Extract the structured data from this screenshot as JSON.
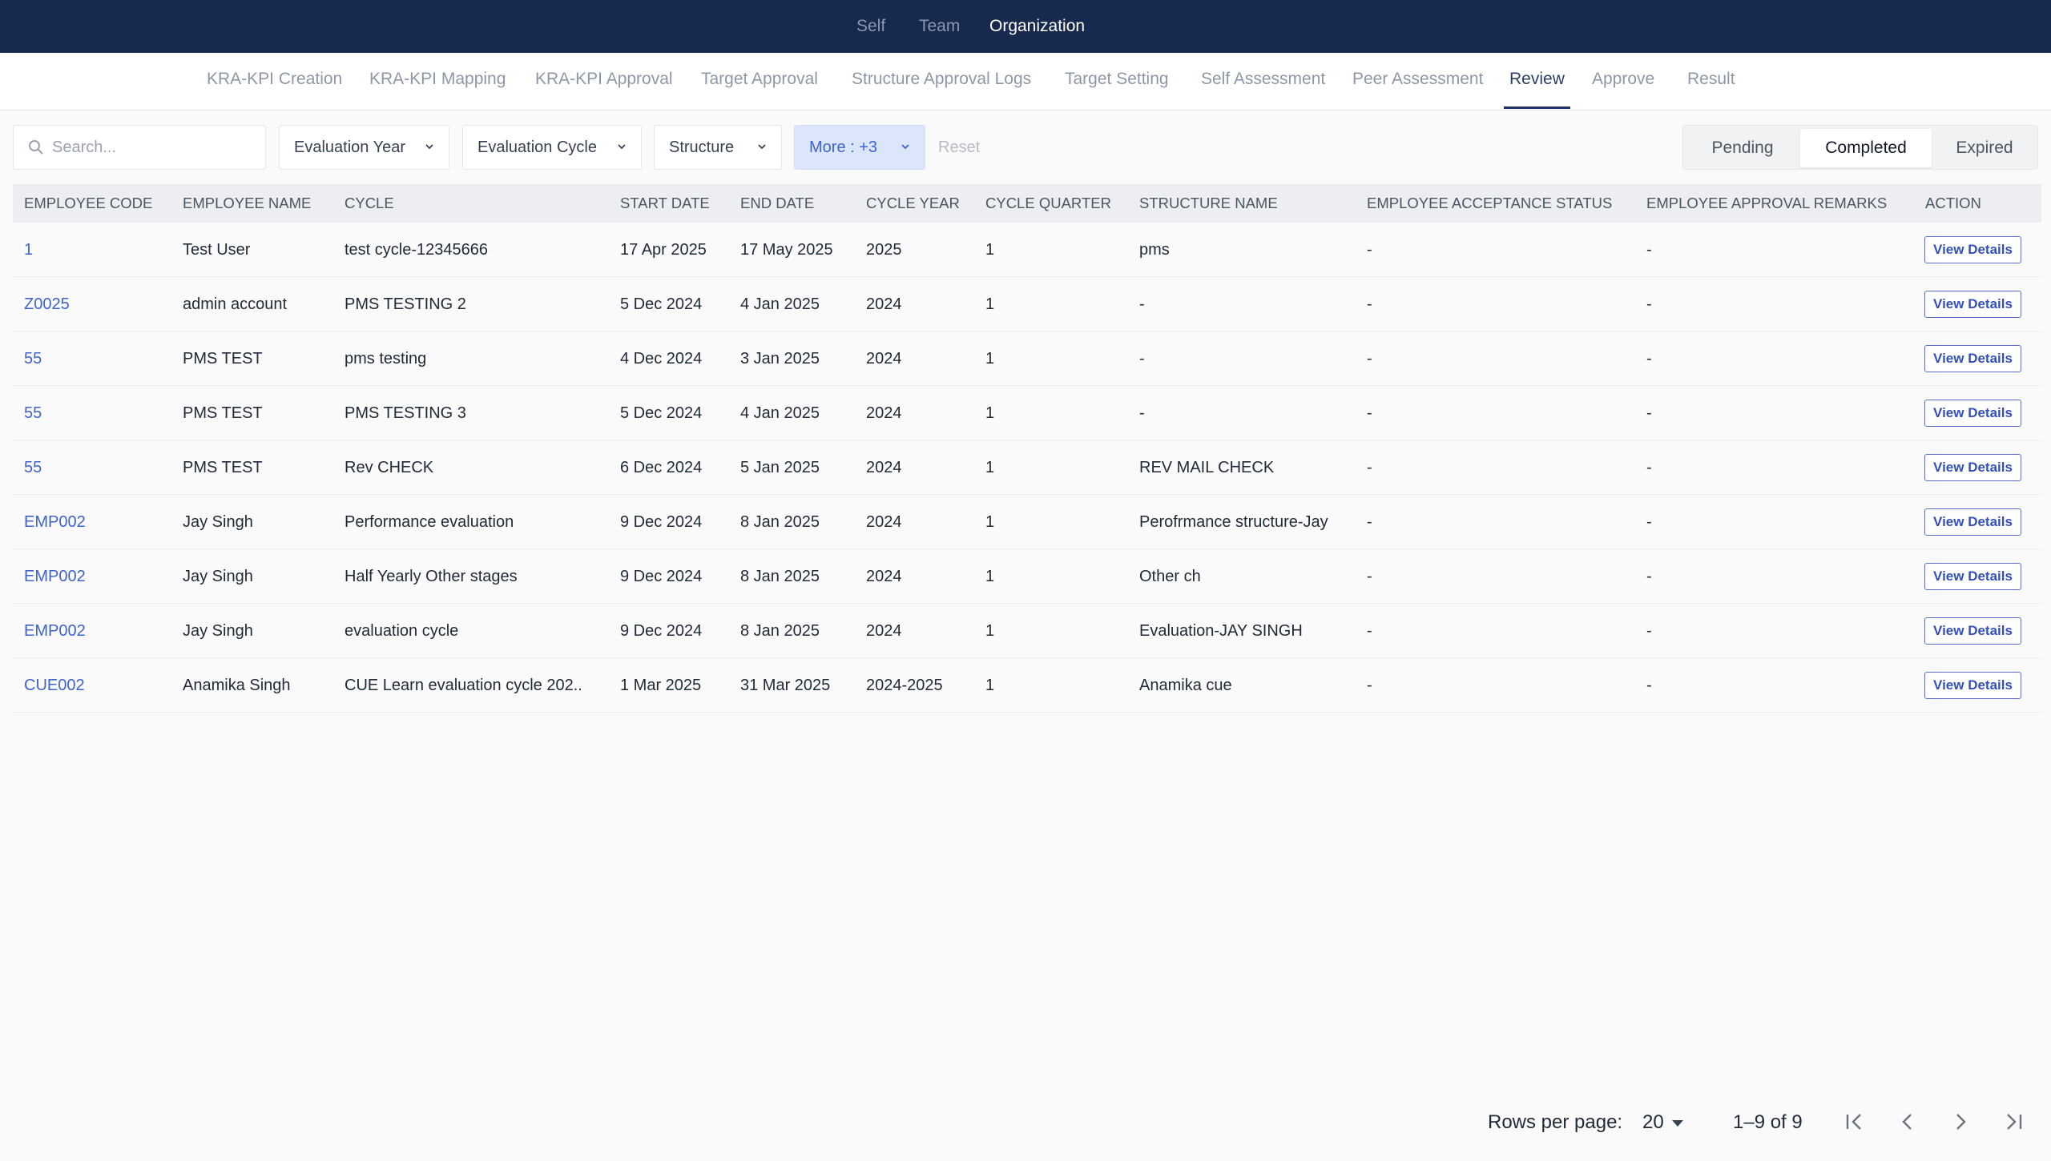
{
  "top_nav": {
    "self": "Self",
    "team": "Team",
    "organization": "Organization"
  },
  "sub_nav": [
    "KRA-KPI Creation",
    "KRA-KPI Mapping",
    "KRA-KPI Approval",
    "Target Approval",
    "Structure Approval Logs",
    "Target Setting",
    "Self Assessment",
    "Peer Assessment",
    "Review",
    "Approve",
    "Result"
  ],
  "filters": {
    "search_placeholder": "Search...",
    "evaluation_year": "Evaluation Year",
    "evaluation_cycle": "Evaluation Cycle",
    "structure": "Structure",
    "more": "More : +3",
    "reset": "Reset"
  },
  "status_tabs": {
    "pending": "Pending",
    "completed": "Completed",
    "expired": "Expired",
    "selected": "Completed"
  },
  "table": {
    "headers": [
      "EMPLOYEE CODE",
      "EMPLOYEE NAME",
      "CYCLE",
      "START DATE",
      "END DATE",
      "CYCLE YEAR",
      "CYCLE QUARTER",
      "STRUCTURE NAME",
      "EMPLOYEE ACCEPTANCE STATUS",
      "EMPLOYEE APPROVAL REMARKS",
      "ACTION"
    ],
    "action_label": "View Details",
    "rows": [
      [
        "1",
        "Test User",
        "test cycle-12345666",
        "17 Apr 2025",
        "17 May 2025",
        "2025",
        "1",
        "pms",
        "-",
        "-"
      ],
      [
        "Z0025",
        "admin account",
        "PMS TESTING 2",
        "5 Dec 2024",
        "4 Jan 2025",
        "2024",
        "1",
        "-",
        "-",
        "-"
      ],
      [
        "55",
        "PMS TEST",
        "pms testing",
        "4 Dec 2024",
        "3 Jan 2025",
        "2024",
        "1",
        "-",
        "-",
        "-"
      ],
      [
        "55",
        "PMS TEST",
        "PMS TESTING 3",
        "5 Dec 2024",
        "4 Jan 2025",
        "2024",
        "1",
        "-",
        "-",
        "-"
      ],
      [
        "55",
        "PMS TEST",
        "Rev CHECK",
        "6 Dec 2024",
        "5 Jan 2025",
        "2024",
        "1",
        "REV MAIL CHECK",
        "-",
        "-"
      ],
      [
        "EMP002",
        "Jay Singh",
        "Performance evaluation",
        "9 Dec 2024",
        "8 Jan 2025",
        "2024",
        "1",
        "Perofrmance structure-Jay",
        "-",
        "-"
      ],
      [
        "EMP002",
        "Jay Singh",
        "Half Yearly Other stages",
        "9 Dec 2024",
        "8 Jan 2025",
        "2024",
        "1",
        "Other ch",
        "-",
        "-"
      ],
      [
        "EMP002",
        "Jay Singh",
        "evaluation cycle",
        "9 Dec 2024",
        "8 Jan 2025",
        "2024",
        "1",
        "Evaluation-JAY SINGH",
        "-",
        "-"
      ],
      [
        "CUE002",
        "Anamika Singh",
        "CUE Learn evaluation cycle 202..",
        "1 Mar 2025",
        "31 Mar 2025",
        "2024-2025",
        "1",
        "Anamika cue",
        "-",
        "-"
      ]
    ]
  },
  "pagination": {
    "rows_per_page_label": "Rows per page:",
    "rows_per_page": "20",
    "range": "1–9 of 9"
  },
  "colors": {
    "header_bg": "#172a4d",
    "link": "#3f63c9",
    "accent": "#1f3263",
    "more_bg": "#dce6fb"
  }
}
